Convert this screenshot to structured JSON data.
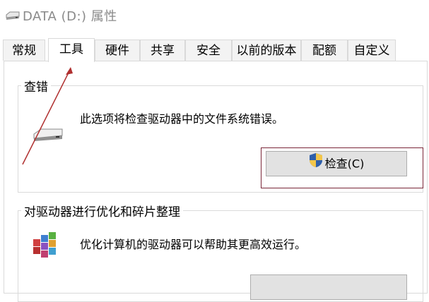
{
  "window": {
    "title": "DATA (D:) 属性",
    "icon": "drive-icon"
  },
  "tabs": [
    {
      "label": "常规",
      "active": false
    },
    {
      "label": "工具",
      "active": true
    },
    {
      "label": "硬件",
      "active": false
    },
    {
      "label": "共享",
      "active": false
    },
    {
      "label": "安全",
      "active": false
    },
    {
      "label": "以前的版本",
      "active": false
    },
    {
      "label": "配额",
      "active": false
    },
    {
      "label": "自定义",
      "active": false
    }
  ],
  "error_check": {
    "title": "查错",
    "description": "此选项将检查驱动器中的文件系统错误。",
    "button_label": "检查(C)",
    "icon": "drive-icon",
    "button_icon": "shield-icon"
  },
  "optimize": {
    "title": "对驱动器进行优化和碎片整理",
    "description": "优化计算机的驱动器可以帮助其更高效运行。",
    "icon": "defrag-icon"
  },
  "colors": {
    "highlight_border": "#7a2638",
    "arrow": "#b03030"
  }
}
